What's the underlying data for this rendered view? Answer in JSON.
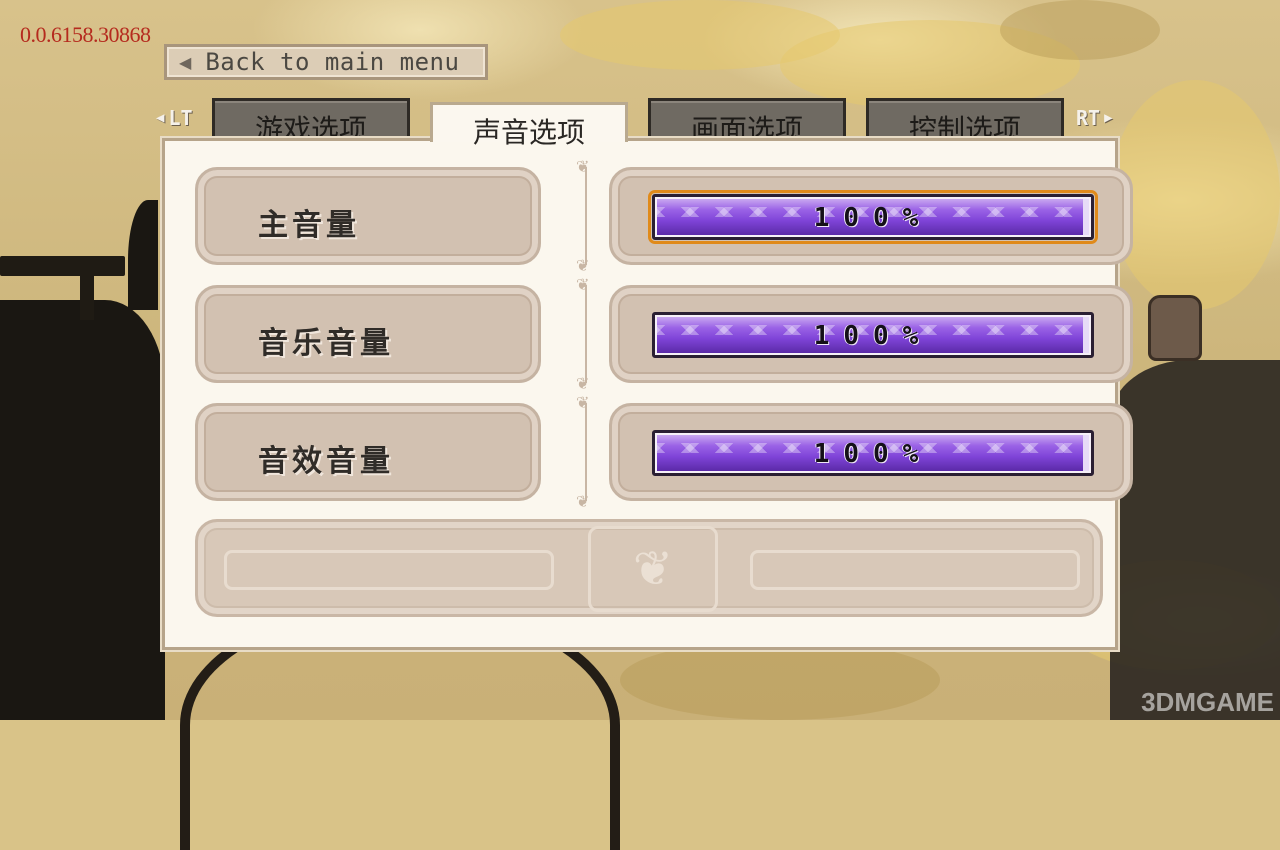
{
  "debug": {
    "version": "0.0.6158.30868"
  },
  "nav": {
    "back_label": "Back to main menu"
  },
  "tabs": {
    "left_shoulder": "LT",
    "right_shoulder": "RT",
    "items": [
      {
        "label": "游戏选项",
        "active": false
      },
      {
        "label": "声音选项",
        "active": true
      },
      {
        "label": "画面选项",
        "active": false
      },
      {
        "label": "控制选项",
        "active": false
      }
    ]
  },
  "settings": [
    {
      "label": "主音量",
      "value_text": "100%",
      "value": 1.0
    },
    {
      "label": "音乐音量",
      "value_text": "100%",
      "value": 1.0
    },
    {
      "label": "音效音量",
      "value_text": "100%",
      "value": 1.0
    }
  ],
  "watermark": "3DMGAME",
  "colors": {
    "slider_fill": "#7f44d8",
    "focus_outline": "#e08a1a",
    "panel_bg": "#fbf7ee",
    "version_text": "#b52a1e"
  }
}
